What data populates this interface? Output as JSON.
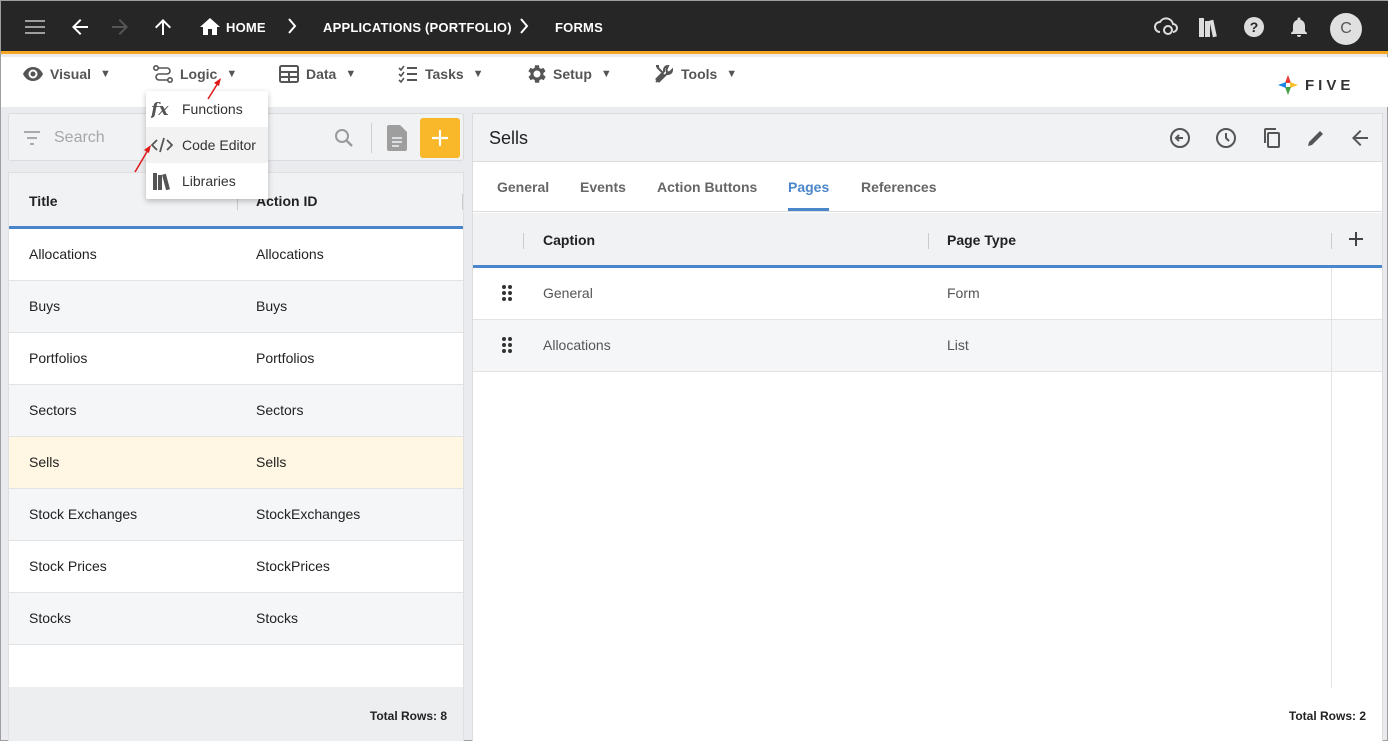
{
  "topbar": {
    "breadcrumbs": [
      "HOME",
      "APPLICATIONS (PORTFOLIO)",
      "FORMS"
    ],
    "avatar_initial": "C",
    "accent": "#f5a623",
    "icons": [
      "menu-icon",
      "back-arrow-icon",
      "forward-arrow-icon",
      "up-arrow-icon",
      "home-icon",
      "cloud-sync-icon",
      "library-icon",
      "help-icon",
      "bell-icon"
    ]
  },
  "menubar": {
    "items": [
      {
        "label": "Visual",
        "icon": "eye-icon"
      },
      {
        "label": "Logic",
        "icon": "logic-icon"
      },
      {
        "label": "Data",
        "icon": "table-icon"
      },
      {
        "label": "Tasks",
        "icon": "tasks-icon"
      },
      {
        "label": "Setup",
        "icon": "gear-icon"
      },
      {
        "label": "Tools",
        "icon": "tools-icon"
      }
    ],
    "caret": "▼",
    "logo_text": "FIVE"
  },
  "logic_menu": {
    "items": [
      {
        "label": "Functions",
        "icon": "fx-icon"
      },
      {
        "label": "Code Editor",
        "icon": "code-icon"
      },
      {
        "label": "Libraries",
        "icon": "libraries-icon"
      }
    ]
  },
  "left": {
    "search_placeholder": "Search",
    "columns": [
      "Title",
      "Action ID"
    ],
    "rows": [
      {
        "title": "Allocations",
        "action_id": "Allocations"
      },
      {
        "title": "Buys",
        "action_id": "Buys"
      },
      {
        "title": "Portfolios",
        "action_id": "Portfolios"
      },
      {
        "title": "Sectors",
        "action_id": "Sectors"
      },
      {
        "title": "Sells",
        "action_id": "Sells"
      },
      {
        "title": "Stock Exchanges",
        "action_id": "StockExchanges"
      },
      {
        "title": "Stock Prices",
        "action_id": "StockPrices"
      },
      {
        "title": "Stocks",
        "action_id": "Stocks"
      }
    ],
    "selected_row": "Sells",
    "total_rows": "Total Rows: 8"
  },
  "right": {
    "title": "Sells",
    "tabs": [
      "General",
      "Events",
      "Action Buttons",
      "Pages",
      "References"
    ],
    "active_tab": "Pages",
    "columns": [
      "Caption",
      "Page Type"
    ],
    "rows": [
      {
        "caption": "General",
        "page_type": "Form"
      },
      {
        "caption": "Allocations",
        "page_type": "List"
      }
    ],
    "total_rows": "Total Rows: 2",
    "accent": "#4a86c9"
  }
}
